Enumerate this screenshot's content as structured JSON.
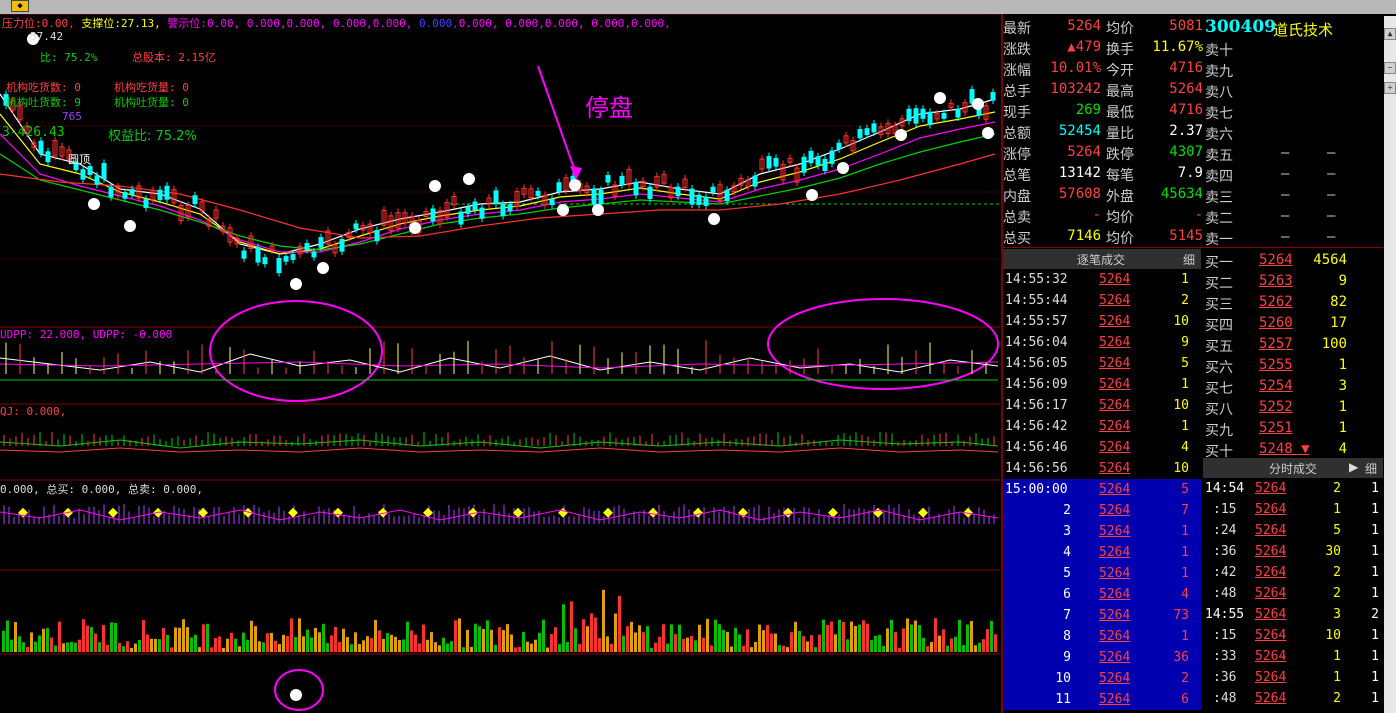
{
  "toolbar": {
    "icon": "app-logo-icon"
  },
  "main_header": {
    "items": [
      "压力位:",
      "0.00,",
      "支撑位:",
      "27.13,",
      "警示位:",
      "0.00,",
      "0.000,",
      "0.000,",
      "0.000,",
      "0.000,",
      "0.000,",
      "0.000,",
      "0.000,",
      "0.000,",
      "0.000,",
      "0.000,"
    ]
  },
  "main_labels": {
    "price_top": "57.42",
    "ratio_left": "比: 75.2%",
    "total_equity": "总股本: 2.15亿",
    "inst_buy": "机构吃货数: 0",
    "inst_sell": "机构吐货数: 9",
    "inst_buy_vol": "机构吃货量: 0",
    "inst_sell_vol": "机构吐货量: 0",
    "left_value": "765",
    "left_value2": "3-426.43",
    "equity_ratio": "权益比: 75.2%",
    "round_top": "圆顶",
    "annotation": "停盘"
  },
  "sub_headers": {
    "p1": "UDPP: 22.000, UDPP: -0.000",
    "p2": "QJ: 0.000,",
    "p3": "0.000, 总买: 0.000, 总卖: 0.000,"
  },
  "stock": {
    "code": "300409",
    "name": "道氏技术"
  },
  "quote": [
    {
      "l1": "最新",
      "v1": "5264",
      "l2": "均价",
      "v2": "5081"
    },
    {
      "l1": "涨跌",
      "v1": "▲479",
      "l2": "换手",
      "v2": "11.67%"
    },
    {
      "l1": "涨幅",
      "v1": "10.01%",
      "l2": "今开",
      "v2": "4716"
    },
    {
      "l1": "总手",
      "v1": "103242",
      "l2": "最高",
      "v2": "5264"
    },
    {
      "l1": "现手",
      "v1": "269",
      "l2": "最低",
      "v2": "4716"
    },
    {
      "l1": "总额",
      "v1": "52454",
      "l2": "量比",
      "v2": "2.37"
    },
    {
      "l1": "涨停",
      "v1": "5264",
      "l2": "跌停",
      "v2": "4307"
    },
    {
      "l1": "总笔",
      "v1": "13142",
      "l2": "每笔",
      "v2": "7.9"
    },
    {
      "l1": "内盘",
      "v1": "57608",
      "l2": "外盘",
      "v2": "45634"
    },
    {
      "l1": "总卖",
      "v1": "-",
      "l2": "均价",
      "v2": "-"
    },
    {
      "l1": "总买",
      "v1": "7146",
      "l2": "均价",
      "v2": "5145"
    }
  ],
  "sell": [
    {
      "l": "卖十",
      "p": "",
      "v": ""
    },
    {
      "l": "卖九",
      "p": "",
      "v": ""
    },
    {
      "l": "卖八",
      "p": "",
      "v": ""
    },
    {
      "l": "卖七",
      "p": "",
      "v": ""
    },
    {
      "l": "卖六",
      "p": "",
      "v": ""
    },
    {
      "l": "卖五",
      "p": "–",
      "v": "–"
    },
    {
      "l": "卖四",
      "p": "–",
      "v": "–"
    },
    {
      "l": "卖三",
      "p": "–",
      "v": "–"
    },
    {
      "l": "卖二",
      "p": "–",
      "v": "–"
    },
    {
      "l": "卖一",
      "p": "–",
      "v": "–"
    }
  ],
  "buy": [
    {
      "l": "买一",
      "p": "5264",
      "v": "4564"
    },
    {
      "l": "买二",
      "p": "5263",
      "v": "9"
    },
    {
      "l": "买三",
      "p": "5262",
      "v": "82"
    },
    {
      "l": "买四",
      "p": "5260",
      "v": "17"
    },
    {
      "l": "买五",
      "p": "5257",
      "v": "100"
    },
    {
      "l": "买六",
      "p": "5255",
      "v": "1"
    },
    {
      "l": "买七",
      "p": "5254",
      "v": "3"
    },
    {
      "l": "买八",
      "p": "5252",
      "v": "1"
    },
    {
      "l": "买九",
      "p": "5251",
      "v": "1"
    },
    {
      "l": "买十",
      "p": "5248 ▼",
      "v": "4"
    }
  ],
  "ticks_header": {
    "title": "逐笔成交",
    "detail": "细"
  },
  "ticks": [
    {
      "t": "14:55:32",
      "p": "5264",
      "v": "1"
    },
    {
      "t": "14:55:44",
      "p": "5264",
      "v": "2"
    },
    {
      "t": "14:55:57",
      "p": "5264",
      "v": "10"
    },
    {
      "t": "14:56:04",
      "p": "5264",
      "v": "9"
    },
    {
      "t": "14:56:05",
      "p": "5264",
      "v": "5"
    },
    {
      "t": "14:56:09",
      "p": "5264",
      "v": "1"
    },
    {
      "t": "14:56:17",
      "p": "5264",
      "v": "10"
    },
    {
      "t": "14:56:42",
      "p": "5264",
      "v": "1"
    },
    {
      "t": "14:56:46",
      "p": "5264",
      "v": "4"
    },
    {
      "t": "14:56:56",
      "p": "5264",
      "v": "10"
    }
  ],
  "ticks_sel": [
    {
      "t": "15:00:00",
      "p": "5264",
      "v": "5"
    },
    {
      "t": "2",
      "p": "5264",
      "v": "7"
    },
    {
      "t": "3",
      "p": "5264",
      "v": "1"
    },
    {
      "t": "4",
      "p": "5264",
      "v": "1"
    },
    {
      "t": "5",
      "p": "5264",
      "v": "1"
    },
    {
      "t": "6",
      "p": "5264",
      "v": "4"
    },
    {
      "t": "7",
      "p": "5264",
      "v": "73"
    },
    {
      "t": "8",
      "p": "5264",
      "v": "1"
    },
    {
      "t": "9",
      "p": "5264",
      "v": "36"
    },
    {
      "t": "10",
      "p": "5264",
      "v": "2"
    },
    {
      "t": "11",
      "p": "5264",
      "v": "6"
    }
  ],
  "minute_header": {
    "title": "分时成交",
    "detail": "细"
  },
  "minute": [
    {
      "t": "14:54",
      "p": "5264",
      "v": "2",
      "n": "1"
    },
    {
      "t": ":15",
      "p": "5264",
      "v": "1",
      "n": "1"
    },
    {
      "t": ":24",
      "p": "5264",
      "v": "5",
      "n": "1"
    },
    {
      "t": ":36",
      "p": "5264",
      "v": "30",
      "n": "1"
    },
    {
      "t": ":42",
      "p": "5264",
      "v": "2",
      "n": "1"
    },
    {
      "t": ":48",
      "p": "5264",
      "v": "2",
      "n": "1"
    },
    {
      "t": "14:55",
      "p": "5264",
      "v": "3",
      "n": "2"
    },
    {
      "t": ":15",
      "p": "5264",
      "v": "10",
      "n": "1"
    },
    {
      "t": ":33",
      "p": "5264",
      "v": "1",
      "n": "1"
    },
    {
      "t": ":36",
      "p": "5264",
      "v": "1",
      "n": "1"
    },
    {
      "t": ":48",
      "p": "5264",
      "v": "2",
      "n": "1"
    }
  ],
  "colors": {
    "up": "#ff4040",
    "down": "#00e000",
    "highlight": "#ff00ff",
    "bg": "#000000"
  }
}
